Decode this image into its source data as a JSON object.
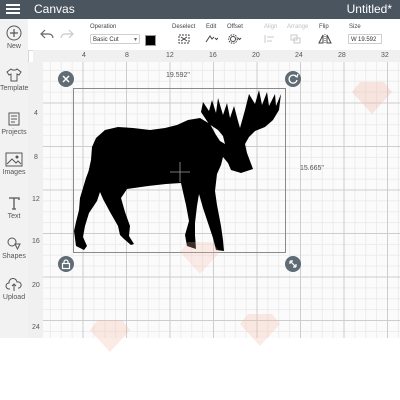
{
  "header": {
    "app_title": "Canvas",
    "document_title": "Untitled*"
  },
  "sidebar": {
    "items": [
      {
        "label": "New",
        "icon": "plus-icon"
      },
      {
        "label": "Templates",
        "icon": "shirt-icon"
      },
      {
        "label": "Projects",
        "icon": "projects-icon"
      },
      {
        "label": "Images",
        "icon": "image-icon"
      },
      {
        "label": "Text",
        "icon": "text-icon"
      },
      {
        "label": "Shapes",
        "icon": "shapes-icon"
      },
      {
        "label": "Upload",
        "icon": "cloud-upload-icon"
      }
    ]
  },
  "toolbar": {
    "operation_label": "Operation",
    "operation_value": "Basic Cut",
    "deselect_label": "Deselect",
    "edit_label": "Edit",
    "offset_label": "Offset",
    "align_label": "Align",
    "arrange_label": "Arrange",
    "flip_label": "Flip",
    "size_label": "Size",
    "width_prefix": "W",
    "width_value": "19.592",
    "linetype_color": "#000000"
  },
  "rulers": {
    "top": [
      "4",
      "8",
      "12",
      "16",
      "20",
      "24",
      "28",
      "32"
    ],
    "left": [
      "4",
      "8",
      "12",
      "16",
      "20",
      "24"
    ]
  },
  "selection": {
    "width_label": "19.592\"",
    "height_label": "15.665\""
  },
  "image": {
    "subject": "moose-silhouette",
    "fill": "#000000"
  }
}
